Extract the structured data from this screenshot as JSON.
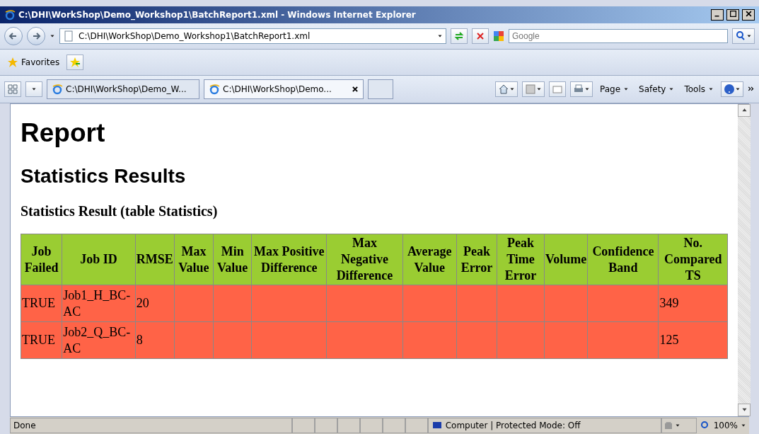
{
  "window": {
    "title": "C:\\DHI\\WorkShop\\Demo_Workshop1\\BatchReport1.xml - Windows Internet Explorer"
  },
  "address_bar": {
    "value": "C:\\DHI\\WorkShop\\Demo_Workshop1\\BatchReport1.xml"
  },
  "search": {
    "placeholder": "Google"
  },
  "favorites_bar": {
    "label": "Favorites"
  },
  "tabs": [
    {
      "label": "C:\\DHI\\WorkShop\\Demo_W...",
      "selected": false
    },
    {
      "label": "C:\\DHI\\WorkShop\\Demo...",
      "selected": true
    }
  ],
  "command_bar": [
    "Page",
    "Safety",
    "Tools"
  ],
  "page": {
    "heading": "Report",
    "subheading": "Statistics Results",
    "table_caption": "Statistics Result (table Statistics)",
    "table": {
      "columns": [
        "Job Failed",
        "Job ID",
        "RMSE",
        "Max Value",
        "Min Value",
        "Max Positive Difference",
        "Max Negative Difference",
        "Average Value",
        "Peak Error",
        "Peak Time Error",
        "Volume",
        "Confidence Band",
        "No. Compared TS"
      ],
      "rows": [
        {
          "job_failed": "TRUE",
          "job_id": "Job1_H_BC-AC",
          "rmse": "20",
          "no_compared_ts": "349"
        },
        {
          "job_failed": "TRUE",
          "job_id": "Job2_Q_BC-AC",
          "rmse": "8",
          "no_compared_ts": "125"
        }
      ]
    }
  },
  "status_bar": {
    "status": "Done",
    "zone": "Computer | Protected Mode: Off",
    "zoom": "100%"
  }
}
